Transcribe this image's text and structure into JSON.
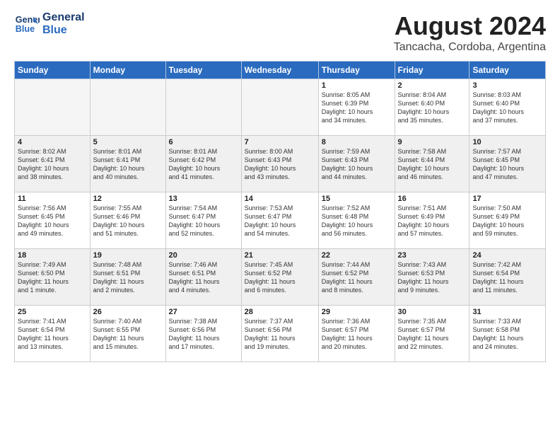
{
  "header": {
    "logo_line1": "General",
    "logo_line2": "Blue",
    "month_year": "August 2024",
    "location": "Tancacha, Cordoba, Argentina"
  },
  "weekdays": [
    "Sunday",
    "Monday",
    "Tuesday",
    "Wednesday",
    "Thursday",
    "Friday",
    "Saturday"
  ],
  "weeks": [
    [
      {
        "day": "",
        "info": ""
      },
      {
        "day": "",
        "info": ""
      },
      {
        "day": "",
        "info": ""
      },
      {
        "day": "",
        "info": ""
      },
      {
        "day": "1",
        "info": "Sunrise: 8:05 AM\nSunset: 6:39 PM\nDaylight: 10 hours\nand 34 minutes."
      },
      {
        "day": "2",
        "info": "Sunrise: 8:04 AM\nSunset: 6:40 PM\nDaylight: 10 hours\nand 35 minutes."
      },
      {
        "day": "3",
        "info": "Sunrise: 8:03 AM\nSunset: 6:40 PM\nDaylight: 10 hours\nand 37 minutes."
      }
    ],
    [
      {
        "day": "4",
        "info": "Sunrise: 8:02 AM\nSunset: 6:41 PM\nDaylight: 10 hours\nand 38 minutes."
      },
      {
        "day": "5",
        "info": "Sunrise: 8:01 AM\nSunset: 6:41 PM\nDaylight: 10 hours\nand 40 minutes."
      },
      {
        "day": "6",
        "info": "Sunrise: 8:01 AM\nSunset: 6:42 PM\nDaylight: 10 hours\nand 41 minutes."
      },
      {
        "day": "7",
        "info": "Sunrise: 8:00 AM\nSunset: 6:43 PM\nDaylight: 10 hours\nand 43 minutes."
      },
      {
        "day": "8",
        "info": "Sunrise: 7:59 AM\nSunset: 6:43 PM\nDaylight: 10 hours\nand 44 minutes."
      },
      {
        "day": "9",
        "info": "Sunrise: 7:58 AM\nSunset: 6:44 PM\nDaylight: 10 hours\nand 46 minutes."
      },
      {
        "day": "10",
        "info": "Sunrise: 7:57 AM\nSunset: 6:45 PM\nDaylight: 10 hours\nand 47 minutes."
      }
    ],
    [
      {
        "day": "11",
        "info": "Sunrise: 7:56 AM\nSunset: 6:45 PM\nDaylight: 10 hours\nand 49 minutes."
      },
      {
        "day": "12",
        "info": "Sunrise: 7:55 AM\nSunset: 6:46 PM\nDaylight: 10 hours\nand 51 minutes."
      },
      {
        "day": "13",
        "info": "Sunrise: 7:54 AM\nSunset: 6:47 PM\nDaylight: 10 hours\nand 52 minutes."
      },
      {
        "day": "14",
        "info": "Sunrise: 7:53 AM\nSunset: 6:47 PM\nDaylight: 10 hours\nand 54 minutes."
      },
      {
        "day": "15",
        "info": "Sunrise: 7:52 AM\nSunset: 6:48 PM\nDaylight: 10 hours\nand 56 minutes."
      },
      {
        "day": "16",
        "info": "Sunrise: 7:51 AM\nSunset: 6:49 PM\nDaylight: 10 hours\nand 57 minutes."
      },
      {
        "day": "17",
        "info": "Sunrise: 7:50 AM\nSunset: 6:49 PM\nDaylight: 10 hours\nand 59 minutes."
      }
    ],
    [
      {
        "day": "18",
        "info": "Sunrise: 7:49 AM\nSunset: 6:50 PM\nDaylight: 11 hours\nand 1 minute."
      },
      {
        "day": "19",
        "info": "Sunrise: 7:48 AM\nSunset: 6:51 PM\nDaylight: 11 hours\nand 2 minutes."
      },
      {
        "day": "20",
        "info": "Sunrise: 7:46 AM\nSunset: 6:51 PM\nDaylight: 11 hours\nand 4 minutes."
      },
      {
        "day": "21",
        "info": "Sunrise: 7:45 AM\nSunset: 6:52 PM\nDaylight: 11 hours\nand 6 minutes."
      },
      {
        "day": "22",
        "info": "Sunrise: 7:44 AM\nSunset: 6:52 PM\nDaylight: 11 hours\nand 8 minutes."
      },
      {
        "day": "23",
        "info": "Sunrise: 7:43 AM\nSunset: 6:53 PM\nDaylight: 11 hours\nand 9 minutes."
      },
      {
        "day": "24",
        "info": "Sunrise: 7:42 AM\nSunset: 6:54 PM\nDaylight: 11 hours\nand 11 minutes."
      }
    ],
    [
      {
        "day": "25",
        "info": "Sunrise: 7:41 AM\nSunset: 6:54 PM\nDaylight: 11 hours\nand 13 minutes."
      },
      {
        "day": "26",
        "info": "Sunrise: 7:40 AM\nSunset: 6:55 PM\nDaylight: 11 hours\nand 15 minutes."
      },
      {
        "day": "27",
        "info": "Sunrise: 7:38 AM\nSunset: 6:56 PM\nDaylight: 11 hours\nand 17 minutes."
      },
      {
        "day": "28",
        "info": "Sunrise: 7:37 AM\nSunset: 6:56 PM\nDaylight: 11 hours\nand 19 minutes."
      },
      {
        "day": "29",
        "info": "Sunrise: 7:36 AM\nSunset: 6:57 PM\nDaylight: 11 hours\nand 20 minutes."
      },
      {
        "day": "30",
        "info": "Sunrise: 7:35 AM\nSunset: 6:57 PM\nDaylight: 11 hours\nand 22 minutes."
      },
      {
        "day": "31",
        "info": "Sunrise: 7:33 AM\nSunset: 6:58 PM\nDaylight: 11 hours\nand 24 minutes."
      }
    ]
  ]
}
